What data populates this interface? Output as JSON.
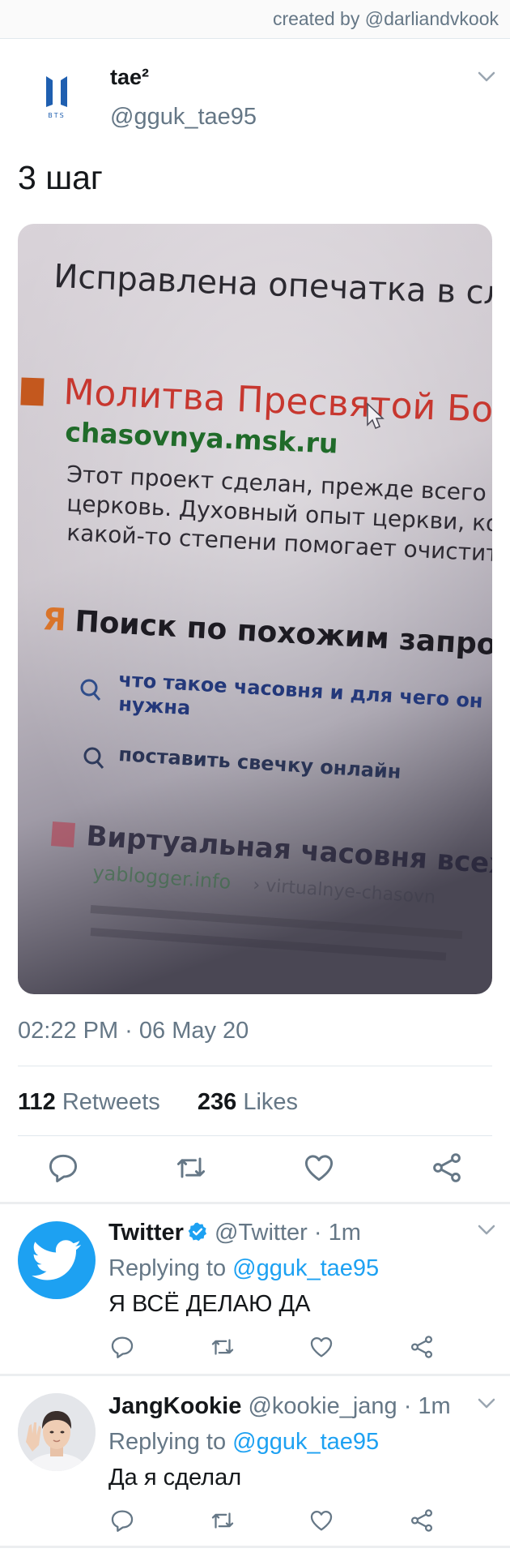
{
  "credit": "created by @darliandvkook",
  "tweet": {
    "name": "tae²",
    "handle": "@gguk_tae95",
    "text": "3 шаг",
    "timestamp": "02:22 PM · 06 May 20",
    "retweets_count": "112",
    "retweets_label": "Retweets",
    "likes_count": "236",
    "likes_label": "Likes"
  },
  "photo": {
    "line1": "Исправлена опечатка в сл",
    "line2": "Молитва Пресвятой Бого",
    "line3": "chasovnya.msk.ru",
    "line4": "Этот проект сделан, прежде всего",
    "line5": "церковь. Духовный опыт церкви, ко",
    "line6": "какой-то степени помогает очистит",
    "line7": "Поиск по похожим запро",
    "line8": "что такое часовня и для чего он",
    "line9": "нужна",
    "line10": "поставить свечку онлайн",
    "line11": "Виртуальная часовня всех",
    "line12": "yablogger.info",
    "line13": "› virtualnye-chasovn"
  },
  "replies": [
    {
      "name": "Twitter",
      "handle_time": "@Twitter · 1m",
      "replying_prefix": "Replying to",
      "replying_to": "@gguk_tae95",
      "text": "Я ВСЁ ДЕЛАЮ ДА"
    },
    {
      "name": "JangKookie",
      "handle_time": "@kookie_jang · 1m",
      "replying_prefix": "Replying to",
      "replying_to": "@gguk_tae95",
      "text": "Да я сделал"
    }
  ],
  "colors": {
    "accent": "#1da1f2",
    "secondary_text": "#657786",
    "divider": "#e1e8ed",
    "bts_blue": "#1f5fb0"
  },
  "icons": [
    "bts-logo-icon",
    "chevron-down-icon",
    "reply-icon",
    "retweet-icon",
    "like-icon",
    "share-icon",
    "twitter-bird-icon",
    "verified-badge-icon"
  ]
}
